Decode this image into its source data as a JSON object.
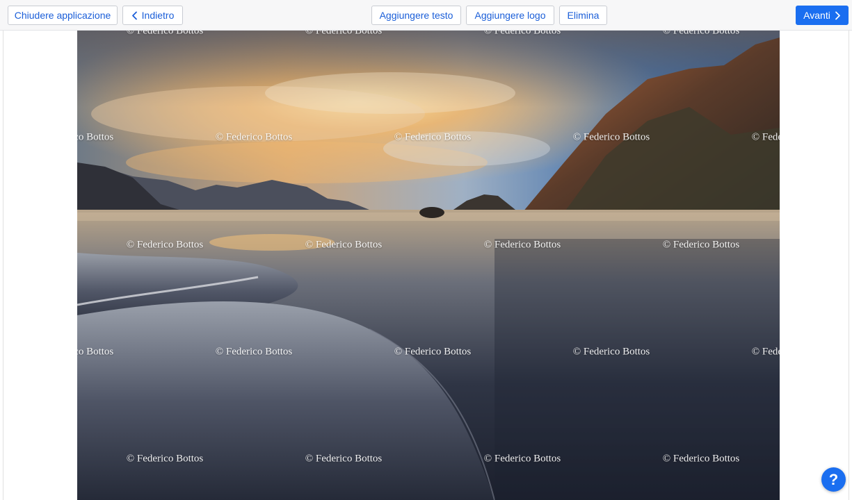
{
  "toolbar": {
    "close_label": "Chiudere applicazione",
    "back_label": "Indietro",
    "add_text_label": "Aggiungere testo",
    "add_logo_label": "Aggiungere logo",
    "delete_label": "Elimina",
    "next_label": "Avanti"
  },
  "watermark": {
    "text": "© Federico Bottos"
  },
  "help": {
    "label": "?"
  },
  "colors": {
    "accent": "#1a6ef0",
    "link": "#1a5ed8"
  },
  "icons": {
    "back": "chevron-left-icon",
    "next": "chevron-right-icon",
    "help": "question-mark-icon"
  }
}
